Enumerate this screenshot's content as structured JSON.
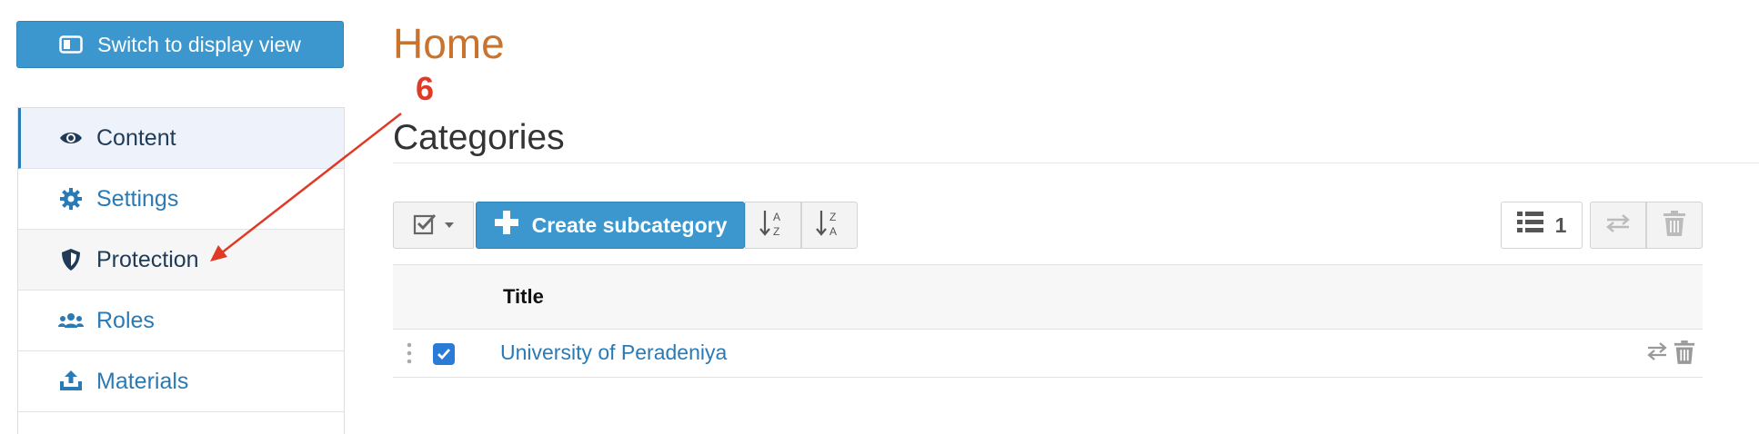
{
  "switch_button": {
    "label": "Switch to display view",
    "icon": "display-view-icon"
  },
  "sidebar": {
    "items": [
      {
        "label": "Content",
        "icon": "eye-icon",
        "state": "active"
      },
      {
        "label": "Settings",
        "icon": "gear-icon",
        "state": "normal"
      },
      {
        "label": "Protection",
        "icon": "shield-icon",
        "state": "hover"
      },
      {
        "label": "Roles",
        "icon": "roles-icon",
        "state": "normal"
      },
      {
        "label": "Materials",
        "icon": "upload-icon",
        "state": "normal"
      }
    ]
  },
  "page": {
    "title": "Home",
    "section_title": "Categories"
  },
  "annotation": {
    "number": "6",
    "color": "#e03a26"
  },
  "toolbar": {
    "select_icon": "checkbox-select-icon",
    "create_label": "Create subcategory",
    "sort_az_icon": "sort-az-icon",
    "sort_za_icon": "sort-za-icon",
    "view_count": "1",
    "move_icon": "move-icon",
    "delete_icon": "trash-icon"
  },
  "table": {
    "columns": [
      "Title"
    ],
    "rows": [
      {
        "title": "University of Peradeniya",
        "checked": true
      }
    ]
  },
  "colors": {
    "accent": "#3d97cf",
    "title": "#c8742f",
    "link": "#2a7ab6"
  }
}
